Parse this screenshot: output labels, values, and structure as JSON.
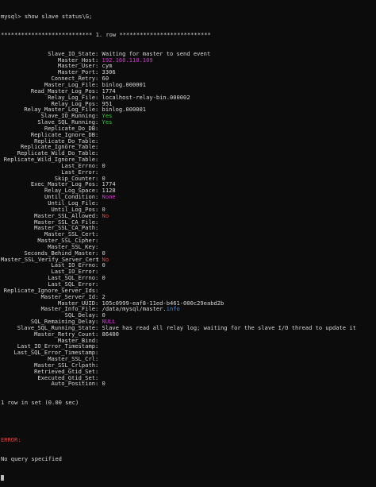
{
  "prompt": "mysql> show slave status\\G;",
  "banner": "*************************** 1. row ***************************",
  "fields": [
    {
      "key": "Slave_IO_State",
      "value": "Waiting for master to send event",
      "style": ""
    },
    {
      "key": "Master_Host",
      "value": "192.168.110.109",
      "style": "ip"
    },
    {
      "key": "Master_User",
      "value": "cym",
      "style": ""
    },
    {
      "key": "Master_Port",
      "value": "3306",
      "style": ""
    },
    {
      "key": "Connect_Retry",
      "value": "60",
      "style": ""
    },
    {
      "key": "Master_Log_File",
      "value": "binlog.000001",
      "style": ""
    },
    {
      "key": "Read_Master_Log_Pos",
      "value": "1774",
      "style": ""
    },
    {
      "key": "Relay_Log_File",
      "value": "localhost-relay-bin.000002",
      "style": ""
    },
    {
      "key": "Relay_Log_Pos",
      "value": "951",
      "style": ""
    },
    {
      "key": "Relay_Master_Log_File",
      "value": "binlog.000001",
      "style": ""
    },
    {
      "key": "Slave_IO_Running",
      "value": "Yes",
      "style": "yes"
    },
    {
      "key": "Slave_SQL_Running",
      "value": "Yes",
      "style": "yes"
    },
    {
      "key": "Replicate_Do_DB",
      "value": "",
      "style": ""
    },
    {
      "key": "Replicate_Ignore_DB",
      "value": "",
      "style": ""
    },
    {
      "key": "Replicate_Do_Table",
      "value": "",
      "style": ""
    },
    {
      "key": "Replicate_Ignore_Table",
      "value": "",
      "style": ""
    },
    {
      "key": "Replicate_Wild_Do_Table",
      "value": "",
      "style": ""
    },
    {
      "key": "Replicate_Wild_Ignore_Table",
      "value": "",
      "style": ""
    },
    {
      "key": "Last_Errno",
      "value": "0",
      "style": ""
    },
    {
      "key": "Last_Error",
      "value": "",
      "style": ""
    },
    {
      "key": "Skip_Counter",
      "value": "0",
      "style": ""
    },
    {
      "key": "Exec_Master_Log_Pos",
      "value": "1774",
      "style": ""
    },
    {
      "key": "Relay_Log_Space",
      "value": "1128",
      "style": ""
    },
    {
      "key": "Until_Condition",
      "value": "None",
      "style": "null"
    },
    {
      "key": "Until_Log_File",
      "value": "",
      "style": ""
    },
    {
      "key": "Until_Log_Pos",
      "value": "0",
      "style": ""
    },
    {
      "key": "Master_SSL_Allowed",
      "value": "No",
      "style": "no"
    },
    {
      "key": "Master_SSL_CA_File",
      "value": "",
      "style": ""
    },
    {
      "key": "Master_SSL_CA_Path",
      "value": "",
      "style": ""
    },
    {
      "key": "Master_SSL_Cert",
      "value": "",
      "style": ""
    },
    {
      "key": "Master_SSL_Cipher",
      "value": "",
      "style": ""
    },
    {
      "key": "Master_SSL_Key",
      "value": "",
      "style": ""
    },
    {
      "key": "Seconds_Behind_Master",
      "value": "0",
      "style": ""
    },
    {
      "key": "Master_SSL_Verify_Server_Cert",
      "value": "No",
      "style": "no"
    },
    {
      "key": "Last_IO_Errno",
      "value": "0",
      "style": ""
    },
    {
      "key": "Last_IO_Error",
      "value": "",
      "style": ""
    },
    {
      "key": "Last_SQL_Errno",
      "value": "0",
      "style": ""
    },
    {
      "key": "Last_SQL_Error",
      "value": "",
      "style": ""
    },
    {
      "key": "Replicate_Ignore_Server_Ids",
      "value": "",
      "style": ""
    },
    {
      "key": "Master_Server_Id",
      "value": "2",
      "style": ""
    },
    {
      "key": "Master_UUID",
      "value": "105c0999-eaf8-11ed-b461-000c29eabd2b",
      "style": ""
    },
    {
      "key": "Master_Info_File",
      "value": "/data/mysql/master.",
      "value2": "info",
      "style": "info"
    },
    {
      "key": "SQL_Delay",
      "value": "0",
      "style": ""
    },
    {
      "key": "SQL_Remaining_Delay",
      "value": "NULL",
      "style": "null"
    },
    {
      "key": "Slave_SQL_Running_State",
      "value": "Slave has read all relay log; waiting for the slave I/O thread to update it",
      "style": ""
    },
    {
      "key": "Master_Retry_Count",
      "value": "86400",
      "style": ""
    },
    {
      "key": "Master_Bind",
      "value": "",
      "style": ""
    },
    {
      "key": "Last_IO_Error_Timestamp",
      "value": "",
      "style": ""
    },
    {
      "key": "Last_SQL_Error_Timestamp",
      "value": "",
      "style": ""
    },
    {
      "key": "Master_SSL_Crl",
      "value": "",
      "style": ""
    },
    {
      "key": "Master_SSL_Crlpath",
      "value": "",
      "style": ""
    },
    {
      "key": "Retrieved_Gtid_Set",
      "value": "",
      "style": ""
    },
    {
      "key": "Executed_Gtid_Set",
      "value": "",
      "style": ""
    },
    {
      "key": "Auto_Position",
      "value": "0",
      "style": ""
    }
  ],
  "result_summary": "1 row in set (0.00 sec)",
  "error_label": "ERROR:",
  "error_message": "No query specified",
  "colors": {
    "background": "#0c0c0c",
    "text": "#d8d8d8",
    "magenta": "#d03bd0",
    "green": "#3fc93f",
    "red": "#e04545",
    "blue": "#3a8fe0"
  }
}
